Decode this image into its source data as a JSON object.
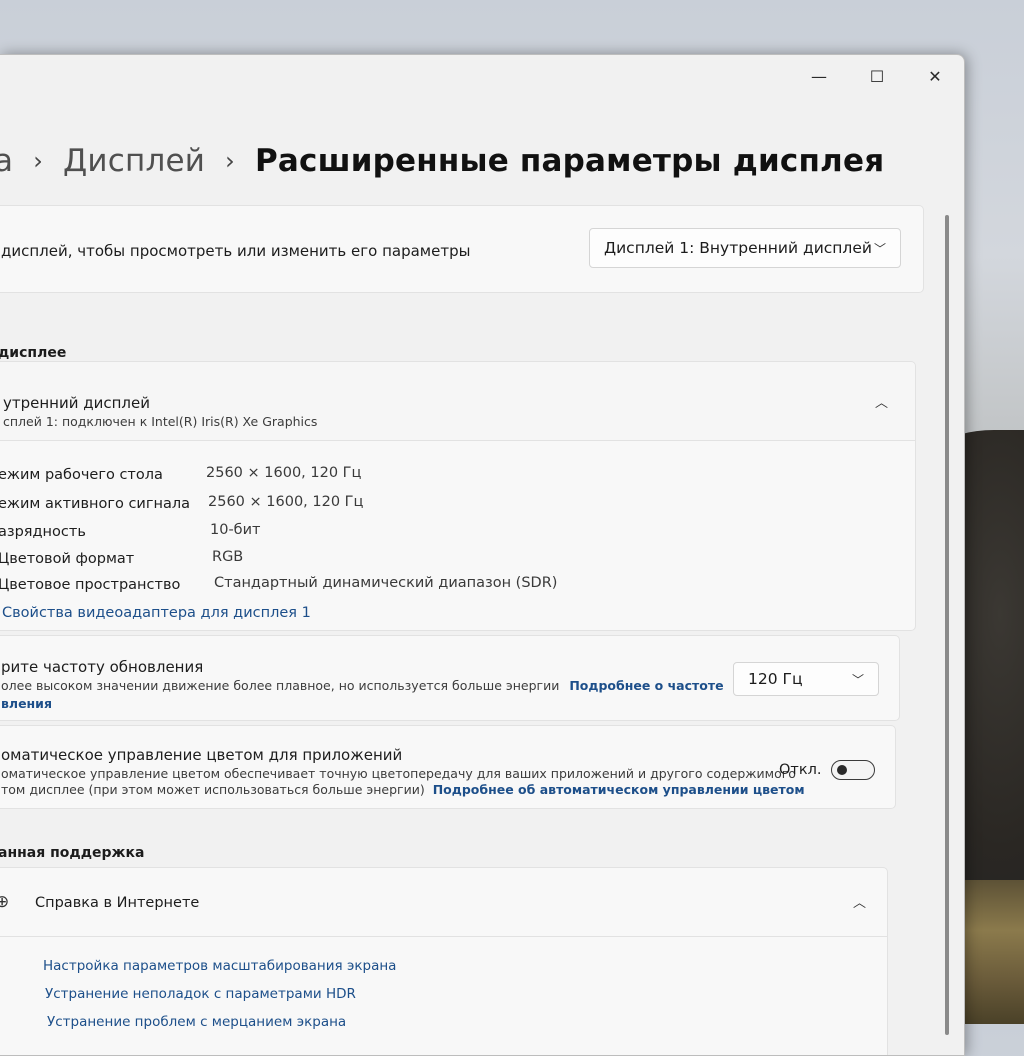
{
  "window": {
    "controls": {
      "minimize": "—",
      "maximize": "☐",
      "close": "✕"
    }
  },
  "breadcrumb": {
    "prev": "а",
    "parent": "Дисплей",
    "current": "Расширенные параметры дисплея",
    "separator": "›"
  },
  "selector": {
    "text": "дисплей, чтобы просмотреть или изменить его параметры",
    "dropdown_value": "Дисплей 1: Внутренний дисплей"
  },
  "info_section": {
    "title": "дисплее",
    "display_name": "утренний дисплей",
    "display_sub": "сплей 1: подключен к Intel(R) Iris(R) Xe Graphics",
    "rows": [
      {
        "label": "ежим рабочего стола",
        "value": "2560 × 1600, 120 Гц"
      },
      {
        "label": "ежим активного сигнала",
        "value": "2560 × 1600, 120 Гц"
      },
      {
        "label": "азрядность",
        "value": "10-бит"
      },
      {
        "label": "Цветовой формат",
        "value": "RGB"
      },
      {
        "label": "Цветовое пространство",
        "value": "Стандартный динамический диапазон (SDR)"
      }
    ],
    "adapter_link": "Свойства видеоадаптера для дисплея 1"
  },
  "refresh": {
    "title": "рите частоту обновления",
    "desc": "олее высоком значении движение более плавное, но используется больше энергии",
    "link_part1": "Подробнее о частоте",
    "link_part2": "вления",
    "value": "120 Гц"
  },
  "color_mgmt": {
    "title": "оматическое управление цветом для приложений",
    "desc1": "оматическое управление цветом обеспечивает точную цветопередачу для ваших приложений и другого содержимого",
    "desc2": "том дисплее (при этом может использоваться больше энергии)",
    "link": "Подробнее об автоматическом управлении цветом",
    "state": "Откл."
  },
  "support": {
    "title": "анная поддержка",
    "help_header": "Справка в Интернете",
    "links": [
      "Настройка параметров масштабирования экрана",
      "Устранение неполадок с параметрами HDR",
      "Устранение проблем с мерцанием экрана"
    ]
  }
}
